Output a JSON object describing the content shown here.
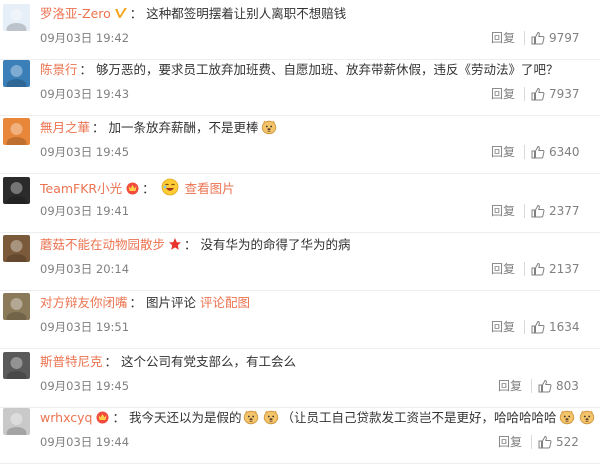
{
  "ui": {
    "reply_label": "回复",
    "like_icon": "thumbs-up-icon"
  },
  "comments": [
    {
      "user": "罗洛亚-Zero",
      "badge": "verified-v-icon",
      "segments": [
        {
          "type": "text",
          "value": "这种都签明摆着让别人离职不想赔钱"
        }
      ],
      "time": "09月03日 19:42",
      "likes": "9797",
      "avatar_color": "#e6eef7"
    },
    {
      "user": "陈景行",
      "badge": "",
      "segments": [
        {
          "type": "text",
          "value": "够万恶的，要求员工放弃加班费、自愿加班、放弃带薪休假，违反《劳动法》了吧？"
        }
      ],
      "time": "09月03日 19:43",
      "likes": "7937",
      "avatar_color": "#3a7fb8"
    },
    {
      "user": "無月之華",
      "badge": "",
      "segments": [
        {
          "type": "text",
          "value": "加一条放弃薪酬，不是更棒"
        },
        {
          "type": "emoji",
          "name": "doge-emoji"
        }
      ],
      "time": "09月03日 19:45",
      "likes": "6340",
      "avatar_color": "#e8873a"
    },
    {
      "user": "TeamFKR小光",
      "badge": "vip-crown-icon",
      "segments": [
        {
          "type": "emoji",
          "name": "laugh-emoji"
        },
        {
          "type": "link",
          "value": "查看图片"
        }
      ],
      "time": "09月03日 19:41",
      "likes": "2377",
      "avatar_color": "#2b2b2b"
    },
    {
      "user": "蘑菇不能在动物园散步",
      "badge": "star-icon",
      "segments": [
        {
          "type": "text",
          "value": "没有华为的命得了华为的病"
        }
      ],
      "time": "09月03日 20:14",
      "likes": "2137",
      "avatar_color": "#7a5a3a"
    },
    {
      "user": "对方辩友你闭嘴",
      "badge": "",
      "segments": [
        {
          "type": "text",
          "value": "图片评论"
        },
        {
          "type": "link",
          "value": "评论配图"
        }
      ],
      "time": "09月03日 19:51",
      "likes": "1634",
      "avatar_color": "#8a7a5a"
    },
    {
      "user": "斯普特尼克",
      "badge": "",
      "segments": [
        {
          "type": "text",
          "value": "这个公司有党支部么，有工会么"
        }
      ],
      "time": "09月03日 19:45",
      "likes": "803",
      "avatar_color": "#5a5a5a"
    },
    {
      "user": "wrhxcyq",
      "badge": "vip-crown-icon",
      "segments": [
        {
          "type": "text",
          "value": "我今天还以为是假的"
        },
        {
          "type": "emoji",
          "name": "doge-emoji"
        },
        {
          "type": "emoji",
          "name": "doge-emoji"
        },
        {
          "type": "text",
          "value": "（让员工自己贷款发工资岂不是更好，哈哈哈哈哈"
        },
        {
          "type": "emoji",
          "name": "doge-emoji"
        },
        {
          "type": "emoji",
          "name": "doge-emoji"
        }
      ],
      "time": "09月03日 19:44",
      "likes": "522",
      "avatar_color": "#c9c9c9"
    }
  ]
}
